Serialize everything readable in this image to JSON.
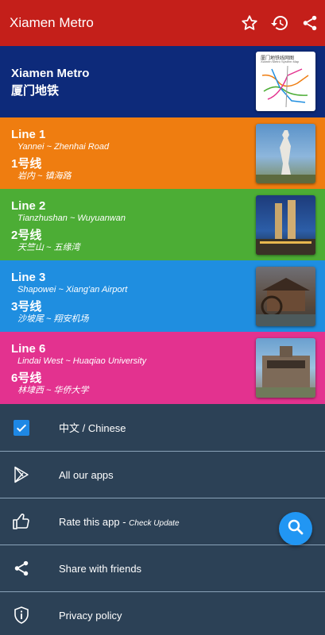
{
  "appbar": {
    "title": "Xiamen Metro",
    "icons": [
      "star-outline-icon",
      "history-icon",
      "share-icon"
    ]
  },
  "header_card": {
    "title": "Xiamen Metro",
    "title_cn": "厦门地铁",
    "map_caption": "厦门地铁线网图",
    "map_caption_en": "Xiamen Metro System Map",
    "color": "#0d2a7a"
  },
  "lines": [
    {
      "name": "Line 1",
      "route": "Yannei ~ Zhenhai Road",
      "name_cn": "1号线",
      "route_cn": "岩内 ~ 镇海路",
      "color": "#ef7d10"
    },
    {
      "name": "Line 2",
      "route": "Tianzhushan ~ Wuyuanwan",
      "name_cn": "2号线",
      "route_cn": "天竺山 ~ 五缘湾",
      "color": "#4cad35"
    },
    {
      "name": "Line 3",
      "route": "Shapowei ~ Xiang'an Airport",
      "name_cn": "3号线",
      "route_cn": "沙坡尾 ~ 翔安机场",
      "color": "#1f8ee0"
    },
    {
      "name": "Line 6",
      "route": "Lindai West ~ Huaqiao University",
      "name_cn": "6号线",
      "route_cn": "林埭西 ~ 华侨大学",
      "color": "#e3328f"
    }
  ],
  "menu": {
    "chinese": {
      "label": "中文 / Chinese",
      "checked": true
    },
    "apps": {
      "label": "All our apps"
    },
    "rate": {
      "label": "Rate this app - ",
      "sub": "Check Update"
    },
    "share": {
      "label": "Share with friends"
    },
    "privacy": {
      "label": "Privacy policy"
    }
  },
  "fab": {
    "icon": "search-icon"
  }
}
